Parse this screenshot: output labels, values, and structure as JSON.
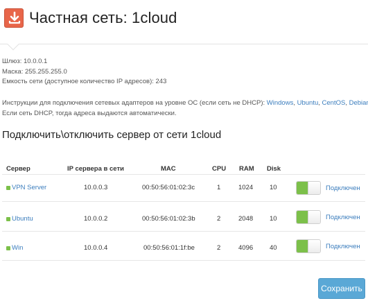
{
  "header": {
    "title": "Частная сеть: 1cloud",
    "icon": "download-icon",
    "icon_color": "#e8664a"
  },
  "network": {
    "gateway": "Шлюз: 10.0.0.1",
    "mask": "Маска: 255.255.255.0",
    "capacity": "Емкость сети (доступное количество IP адресов): 243"
  },
  "instructions": {
    "prefix": "Инструкции для подключения сетевых адаптеров на уровне ОС (если сеть не DHCP): ",
    "links": [
      "Windows",
      "Ubuntu",
      "CentOS",
      "Debian"
    ],
    "sep1": ", ",
    "sep2": ", ",
    "sep3": ", ",
    "line2": "Если сеть DHCP, тогда адреса выдаются автоматически."
  },
  "section_title": "Подключить\\отключить сервер от сети 1cloud",
  "table": {
    "headers": {
      "server": "Сервер",
      "ip": "IP сервера в сети",
      "mac": "MAC",
      "cpu": "CPU",
      "ram": "RAM",
      "disk": "Disk"
    },
    "rows": [
      {
        "name": "VPN Server",
        "ip": "10.0.0.3",
        "mac": "00:50:56:01:02:3c",
        "cpu": "1",
        "ram": "1024",
        "disk": "10",
        "status": "Подключен",
        "connected": true
      },
      {
        "name": "Ubuntu",
        "ip": "10.0.0.2",
        "mac": "00:50:56:01:02:3b",
        "cpu": "2",
        "ram": "2048",
        "disk": "10",
        "status": "Подключен",
        "connected": true
      },
      {
        "name": "Win",
        "ip": "10.0.0.4",
        "mac": "00:50:56:01:1f:be",
        "cpu": "2",
        "ram": "4096",
        "disk": "40",
        "status": "Подключен",
        "connected": true
      }
    ]
  },
  "save_button": "Сохранить",
  "colors": {
    "accent": "#3b7dbd",
    "toggle_on": "#7cc04a",
    "button": "#5aa8d6"
  }
}
